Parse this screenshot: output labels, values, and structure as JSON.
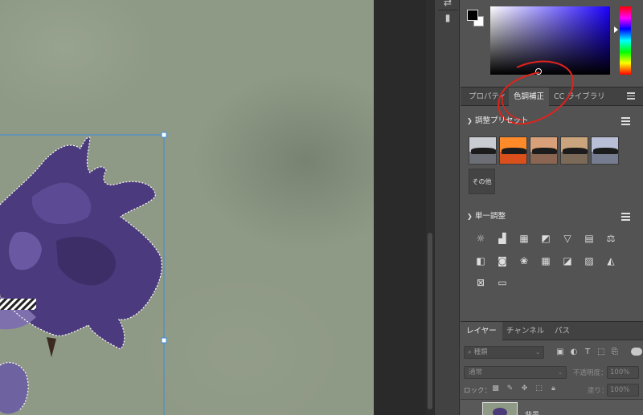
{
  "tabs": {
    "properties": "プロパティ",
    "adjustments": "色調補正",
    "cc_libraries": "CC ライブラリ"
  },
  "adjustments_panel": {
    "presets_title": "調整プリセット",
    "more_label": "その他",
    "single_title": "単一調整",
    "preset_colors": [
      {
        "sky": "#c9ccd2",
        "water": "#6b6e74"
      },
      {
        "sky": "#ff8a2a",
        "water": "#d9501c"
      },
      {
        "sky": "#d9a07a",
        "water": "#8a6552"
      },
      {
        "sky": "#c9a47c",
        "water": "#7c6a58"
      },
      {
        "sky": "#b8bfd6",
        "water": "#777d90"
      }
    ],
    "icons": [
      "brightness-contrast-icon",
      "levels-icon",
      "curves-icon",
      "exposure-icon",
      "vibrance-icon",
      "hue-saturation-icon",
      "color-balance-icon",
      "black-white-icon",
      "photo-filter-icon",
      "channel-mixer-icon",
      "color-lookup-icon",
      "invert-icon",
      "posterize-icon",
      "threshold-icon",
      "selective-color-icon",
      "gradient-map-icon"
    ]
  },
  "layers_panel": {
    "tabs": {
      "layers": "レイヤー",
      "channels": "チャンネル",
      "paths": "パス"
    },
    "filter_placeholder": "種類",
    "blend_mode": "通常",
    "opacity_label": "不透明度：",
    "opacity_value": "100%",
    "lock_label": "ロック：",
    "fill_label": "塗り：",
    "fill_value": "100%",
    "layer_name": "背景"
  },
  "colors": {
    "annotation_red": "#e0231c",
    "selection_blue": "#3b8ee0"
  }
}
